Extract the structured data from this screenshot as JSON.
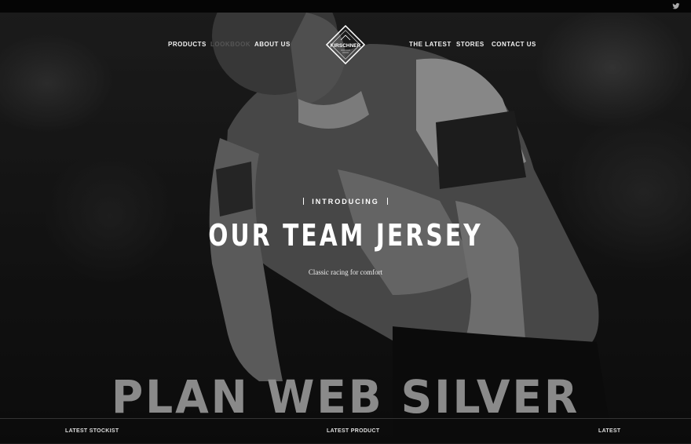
{
  "nav": {
    "products": "PRODUCTS",
    "lookbook": "LOOKBOOK",
    "about": "ABOUT US",
    "latest": "THE LATEST",
    "stores": "STORES",
    "contact": "CONTACT US"
  },
  "logo": {
    "text": "KIRSCHNER"
  },
  "hero": {
    "kicker": "INTRODUCING",
    "title": "OUR TEAM JERSEY",
    "tagline": "Classic racing for comfort"
  },
  "watermark": "PLAN WEB SILVER",
  "footer": {
    "stockist": "LATEST STOCKIST",
    "product": "LATEST PRODUCT",
    "latest": "LATEST"
  },
  "icons": {
    "social": "twitter-icon"
  }
}
